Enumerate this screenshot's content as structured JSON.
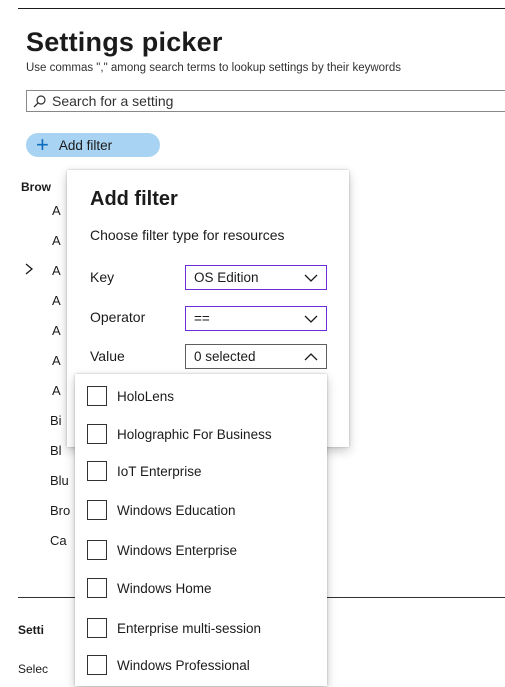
{
  "header": {
    "title": "Settings picker",
    "subtitle": "Use commas \",\" among search terms to lookup settings by their keywords"
  },
  "search": {
    "placeholder": "Search for a setting"
  },
  "add_filter_button": {
    "label": "Add filter",
    "icon": "plus-icon"
  },
  "browse": {
    "heading": "Brow",
    "rows": [
      "A",
      "A",
      "A",
      "A",
      "A",
      "A",
      "A",
      "Bi",
      "Bl",
      "Blu",
      "Bro",
      "Ca"
    ]
  },
  "footer": {
    "settings_heading": "Setti",
    "selected_text": "Selec"
  },
  "filter_popup": {
    "title": "Add filter",
    "description": "Choose filter type for resources",
    "key_label": "Key",
    "key_value": "OS Edition",
    "operator_label": "Operator",
    "operator_value": "==",
    "value_label": "Value",
    "value_value": "0 selected",
    "options": [
      "HoloLens",
      "Holographic For Business",
      "IoT Enterprise",
      "Windows Education",
      "Windows Enterprise",
      "Windows Home",
      "Enterprise multi-session",
      "Windows Professional"
    ]
  },
  "colors": {
    "accent": "#0f6cbd",
    "button_bg": "#a8d3f2",
    "focus_border": "#6c2bd9"
  }
}
